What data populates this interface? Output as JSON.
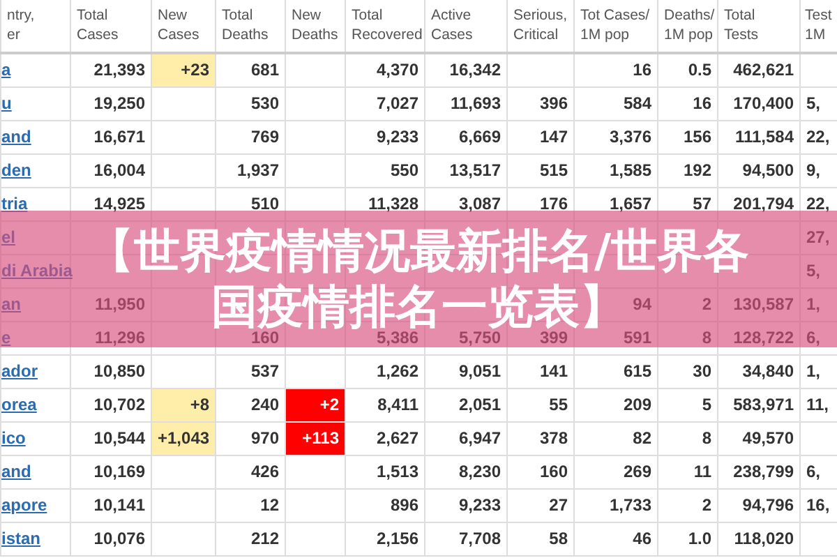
{
  "table": {
    "columns": [
      "ntry,\ner",
      "Total\nCases",
      "New\nCases",
      "Total\nDeaths",
      "New\nDeaths",
      "Total\nRecovered",
      "Active\nCases",
      "Serious,\nCritical",
      "Tot Cases/\n1M pop",
      "Deaths/\n1M pop",
      "Total\nTests",
      "Test\n1M"
    ],
    "rows": [
      {
        "cells": [
          "a",
          "21,393",
          "+23",
          "681",
          null,
          "4,370",
          "16,342",
          null,
          "16",
          "0.5",
          "462,621",
          null
        ]
      },
      {
        "cells": [
          "u",
          "19,250",
          null,
          "530",
          null,
          "7,027",
          "11,693",
          "396",
          "584",
          "16",
          "170,400",
          "5,"
        ]
      },
      {
        "cells": [
          "and",
          "16,671",
          null,
          "769",
          null,
          "9,233",
          "6,669",
          "147",
          "3,376",
          "156",
          "111,584",
          "22,"
        ]
      },
      {
        "cells": [
          "den",
          "16,004",
          null,
          "1,937",
          null,
          "550",
          "13,517",
          "515",
          "1,585",
          "192",
          "94,500",
          "9,"
        ]
      },
      {
        "cells": [
          "tria",
          "14,925",
          null,
          "510",
          null,
          "11,328",
          "3,087",
          "176",
          "1,657",
          "57",
          "201,794",
          "22,"
        ]
      },
      {
        "cells": [
          "el",
          null,
          null,
          null,
          null,
          null,
          null,
          null,
          null,
          null,
          null,
          "27,"
        ]
      },
      {
        "cells": [
          "di Arabia",
          null,
          null,
          null,
          null,
          null,
          null,
          null,
          null,
          null,
          null,
          "5,"
        ]
      },
      {
        "cells": [
          "an",
          "11,950",
          null,
          null,
          null,
          null,
          null,
          null,
          "94",
          "2",
          "130,587",
          "1,"
        ]
      },
      {
        "cells": [
          "e",
          "11,296",
          null,
          "160",
          null,
          "5,386",
          "5,750",
          "399",
          "591",
          "8",
          "128,722",
          "6,"
        ]
      },
      {
        "cells": [
          "ador",
          "10,850",
          null,
          "537",
          null,
          "1,262",
          "9,051",
          "141",
          "615",
          "30",
          "34,840",
          "1,"
        ]
      },
      {
        "cells": [
          "orea",
          "10,702",
          "+8",
          "240",
          "+2",
          "8,411",
          "2,051",
          "55",
          "209",
          "5",
          "583,971",
          "11,"
        ]
      },
      {
        "cells": [
          "ico",
          "10,544",
          "+1,043",
          "970",
          "+113",
          "2,627",
          "6,947",
          "378",
          "82",
          "8",
          "49,570",
          null
        ]
      },
      {
        "cells": [
          "and",
          "10,169",
          null,
          "426",
          null,
          "1,513",
          "8,230",
          "160",
          "269",
          "11",
          "238,799",
          "6,"
        ]
      },
      {
        "cells": [
          "apore",
          "10,141",
          null,
          "12",
          null,
          "896",
          "9,233",
          "27",
          "1,733",
          "2",
          "94,796",
          "16,"
        ]
      },
      {
        "cells": [
          "istan",
          "10,076",
          null,
          "212",
          null,
          "2,156",
          "7,708",
          "58",
          "46",
          "1.0",
          "118,020",
          null
        ]
      }
    ]
  },
  "banner": {
    "lines": [
      "【世界疫情情况最新排名/世界各",
      "国疫情排名一览表】"
    ]
  }
}
